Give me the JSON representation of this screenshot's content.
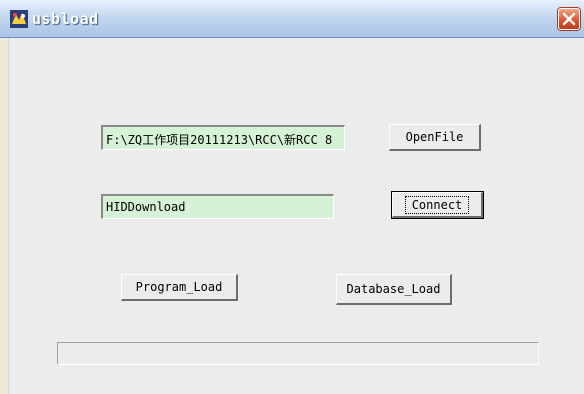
{
  "window": {
    "title": "usbload"
  },
  "fields": {
    "file_path": "F:\\ZQ工作项目20111213\\RCC\\新RCC 8",
    "device_name": "HIDDownload"
  },
  "buttons": {
    "open_file": "OpenFile",
    "connect": "Connect",
    "program_load": "Program_Load",
    "database_load": "Database_Load"
  },
  "progress": {
    "value": 0
  },
  "colors": {
    "field_bg": "#d6f2d6",
    "close_button": "#d8512f",
    "title_bar": "#c3d8f0"
  },
  "icons": {
    "app": "usb-app-icon",
    "close": "close-icon"
  }
}
